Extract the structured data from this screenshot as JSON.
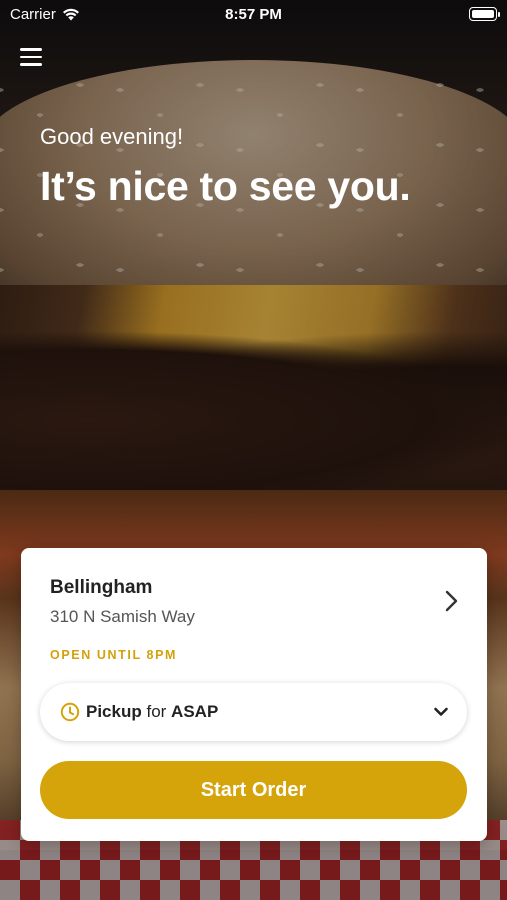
{
  "status_bar": {
    "carrier": "Carrier",
    "time": "8:57 PM"
  },
  "hero": {
    "greeting": "Good evening!",
    "headline": "It’s nice to see you."
  },
  "location": {
    "name": "Bellingham",
    "address": "310 N Samish Way",
    "open_status": "OPEN UNTIL 8PM"
  },
  "order_mode": {
    "mode": "Pickup",
    "connector": " for ",
    "time": "ASAP"
  },
  "start_button": {
    "label": "Start Order"
  },
  "colors": {
    "accent": "#d4a40a",
    "card_bg": "#ffffff"
  },
  "icons": [
    "wifi-icon",
    "battery-icon",
    "menu-icon",
    "chevron-right-icon",
    "clock-icon",
    "chevron-down-icon"
  ]
}
